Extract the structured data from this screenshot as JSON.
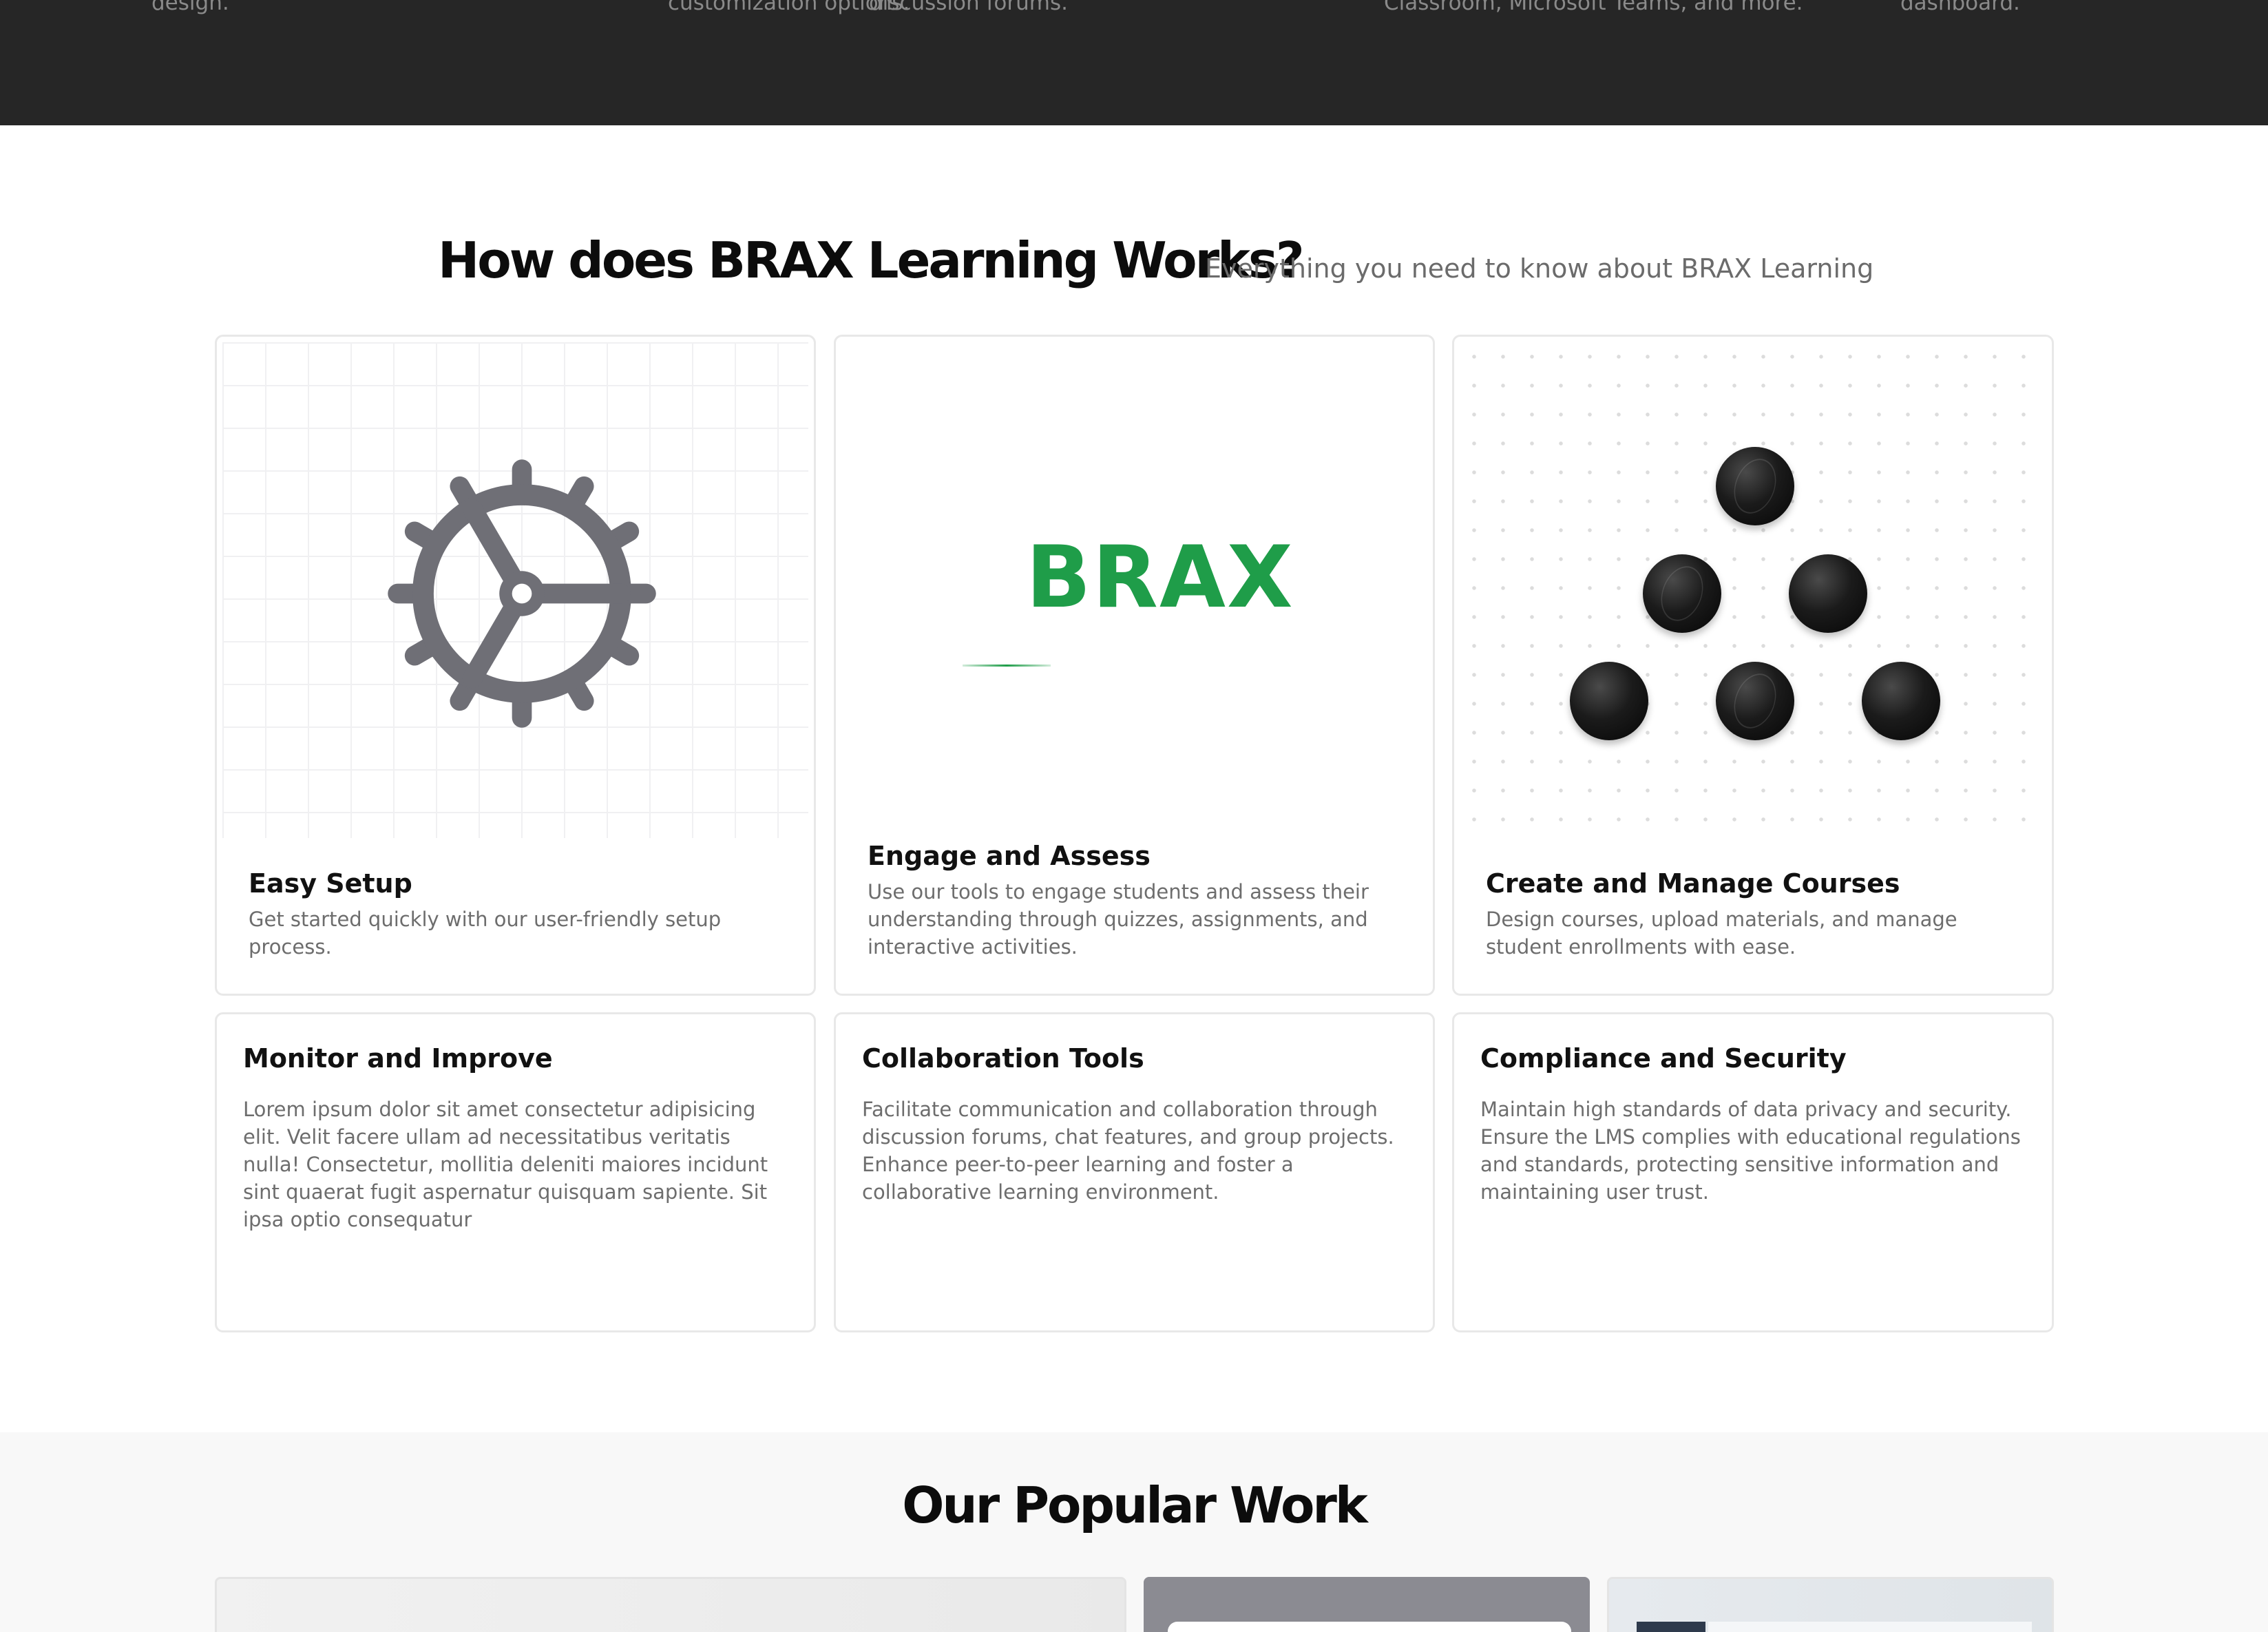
{
  "top_band": {
    "fragments": [
      "design.",
      "customization options.",
      "discussion forums.",
      "Classroom, Microsoft Teams, and more.",
      "dashboard."
    ]
  },
  "how_it_works": {
    "title": "How does BRAX Learning Works?",
    "subtitle": "Everything you need to know about BRAX Learning",
    "cards": [
      {
        "title": "Easy Setup",
        "description": "Get started quickly with our user-friendly setup process.",
        "icon": "gear-icon"
      },
      {
        "title": "Engage and Assess",
        "description": "Use our tools to engage students and assess their understanding through quizzes, assignments, and interactive activities.",
        "logo_text": "BRAX"
      },
      {
        "title": "Create and Manage Courses",
        "description": "Design courses, upload materials, and manage student enrollments with ease.",
        "icon": "spheres-icon"
      },
      {
        "title": "Monitor and Improve",
        "description": "Lorem ipsum dolor sit amet consectetur adipisicing elit. Velit facere ullam ad necessitatibus veritatis nulla! Consectetur, mollitia deleniti maiores incidunt sint quaerat fugit aspernatur quisquam sapiente. Sit ipsa optio consequatur"
      },
      {
        "title": "Collaboration Tools",
        "description": "Facilitate communication and collaboration through discussion forums, chat features, and group projects. Enhance peer-to-peer learning and foster a collaborative learning environment."
      },
      {
        "title": "Compliance and Security",
        "description": "Maintain high standards of data privacy and security. Ensure the LMS complies with educational regulations and standards, protecting sensitive information and maintaining user trust."
      }
    ]
  },
  "popular_work": {
    "title": "Our Popular Work"
  },
  "colors": {
    "brand_green": "#1f9d49",
    "dark_band": "#262626",
    "gear_gray": "#6f6f76"
  }
}
